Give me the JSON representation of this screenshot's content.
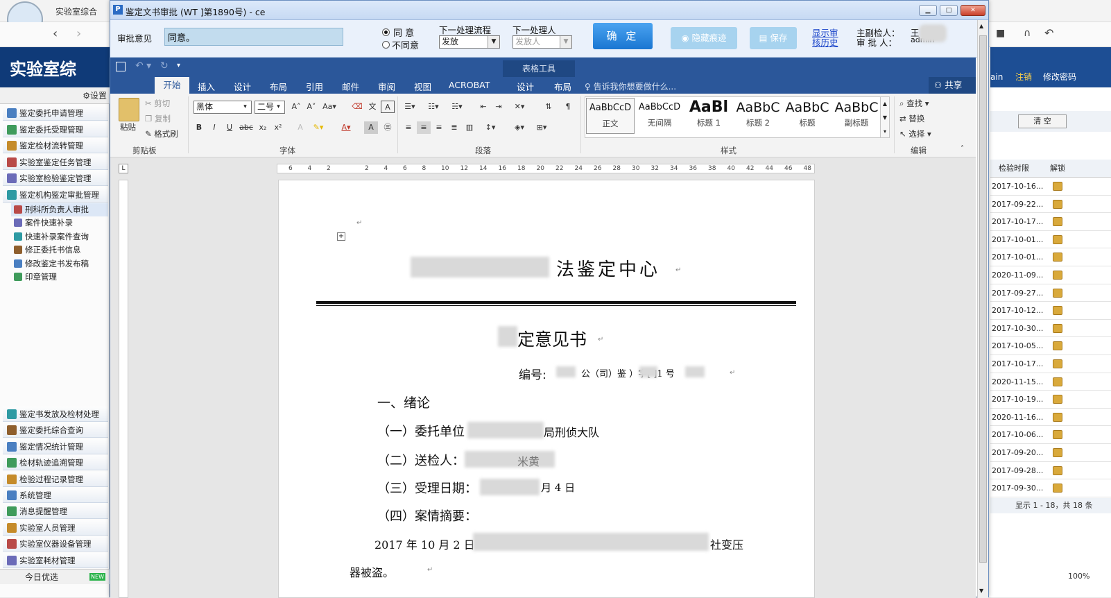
{
  "browser": {
    "tab_title": "实验室综合",
    "header_title": "实验室综",
    "settings_label": "设置",
    "bottom_label": "今日优选",
    "new_badge": "NEW"
  },
  "sidebar": {
    "items_top": [
      "鉴定委托申请管理",
      "鉴定委托受理管理",
      "鉴定检材流转管理",
      "实验室鉴定任务管理",
      "实验室检验鉴定管理",
      "鉴定机构鉴定审批管理"
    ],
    "sub_items": [
      "刑科所负责人审批",
      "案件快速补录",
      "快速补录案件查询",
      "修正委托书信息",
      "修改鉴定书发布稿",
      "印章管理"
    ],
    "items_bottom": [
      "鉴定书发放及检材处理",
      "鉴定委托综合查询",
      "鉴定情况统计管理",
      "检材轨迹追溯管理",
      "检验过程记录管理",
      "系统管理",
      "消息提醒管理",
      "实验室人员管理",
      "实验室仪器设备管理",
      "实验室耗材管理"
    ]
  },
  "bg_right": {
    "login_label": "ain",
    "logout": "注销",
    "change_pwd": "修改密码",
    "clear_btn": "清 空",
    "col_time": "检验时限",
    "col_unlock": "解锁",
    "rows": [
      "2017-10-16...",
      "2017-09-22...",
      "2017-10-17...",
      "2017-10-01...",
      "2017-10-01...",
      "2020-11-09...",
      "2017-09-27...",
      "2017-10-12...",
      "2017-10-30...",
      "2017-10-05...",
      "2017-10-17...",
      "2020-11-15...",
      "2017-10-19...",
      "2020-11-16...",
      "2017-10-06...",
      "2017-09-20...",
      "2017-09-28...",
      "2017-09-30..."
    ],
    "footer": "显示 1 - 18，共 18 条",
    "zoom": "100%"
  },
  "dialog": {
    "title": "鉴定文书审批 (WT        ]第1890号) -           ce",
    "approval_label": "审批意见",
    "approval_value": "同意。",
    "agree": "同 意",
    "disagree": "不同意",
    "next_flow_label": "下一处理流程",
    "next_flow_value": "发放",
    "next_person_label": "下一处理人",
    "next_person_value": "发放人",
    "confirm": "确 定",
    "hide_marks": "隐藏痕迹",
    "save": "保存",
    "history_line1": "显示审",
    "history_line2": "核历史",
    "examiner_label": "主副检人：",
    "examiner_value": "王",
    "examiner_suffix": "一",
    "approver_label": "审 批 人：",
    "approver_value": "admin"
  },
  "word": {
    "table_tools": "表格工具",
    "tabs": [
      "开始",
      "插入",
      "设计",
      "布局",
      "引用",
      "邮件",
      "审阅",
      "视图",
      "ACROBAT",
      "设计",
      "布局"
    ],
    "search_hint": "告诉我你想要做什么...",
    "share": "共享",
    "clipboard": {
      "paste": "粘贴",
      "cut": "剪切",
      "copy": "复制",
      "format_painter": "格式刷",
      "group": "剪贴板"
    },
    "font": {
      "name": "黑体",
      "size": "二号",
      "group": "字体"
    },
    "paragraph_group": "段落",
    "styles": [
      {
        "preview": "AaBbCcD",
        "name": "正文"
      },
      {
        "preview": "AaBbCcD",
        "name": "无间隔"
      },
      {
        "preview": "AaBl",
        "name": "标题 1"
      },
      {
        "preview": "AaBbC",
        "name": "标题 2"
      },
      {
        "preview": "AaBbC",
        "name": "标题"
      },
      {
        "preview": "AaBbC",
        "name": "副标题"
      }
    ],
    "styles_group": "样式",
    "editing": {
      "find": "查找",
      "replace": "替换",
      "select": "选择",
      "group": "编辑"
    },
    "ruler_marks": [
      "6",
      "4",
      "2",
      "",
      "2",
      "4",
      "6",
      "8",
      "10",
      "12",
      "14",
      "16",
      "18",
      "20",
      "22",
      "24",
      "26",
      "28",
      "30",
      "32",
      "34",
      "36",
      "38",
      "40",
      "42",
      "44",
      "46",
      "48"
    ]
  },
  "document": {
    "org_title": "法鉴定中心",
    "doc_title": "定意见书",
    "number_label": "编号:",
    "number_body": "公（司）鉴      ）字[       ]1 号",
    "section1": "一、绪论",
    "item1_label": "（一）委托单位",
    "item1_suffix": "局刑侦大队",
    "item2_label": "（二）送检人：",
    "item2_suffix": "米黄",
    "item3_label": "（三）受理日期：",
    "item3_suffix": "月 4 日",
    "item4_label": "（四）案情摘要：",
    "summary_start": "2017 年 10 月 2 日",
    "summary_end": "社变压",
    "summary_line2": "器被盗。",
    "para_mark": "↵"
  }
}
